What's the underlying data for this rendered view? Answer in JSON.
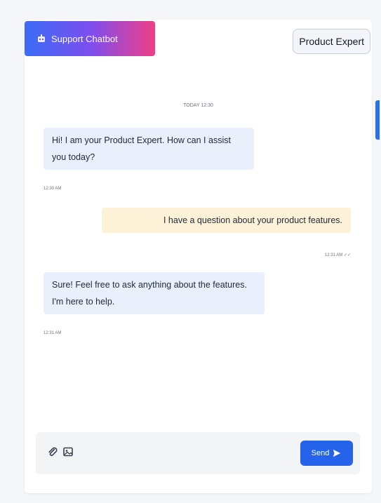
{
  "header": {
    "brand_label": "Support Chatbot",
    "expert_label": "Product Expert"
  },
  "chat": {
    "date_label": "TODAY 12:30",
    "messages": [
      {
        "role": "bot",
        "text": "Hi! I am your Product Expert. How can I assist you today?",
        "time": "12:30 AM"
      },
      {
        "role": "user",
        "text": "I have a question about your product features.",
        "time": "12:31 AM ✓✓"
      },
      {
        "role": "bot",
        "text": "Sure! Feel free to ask anything about the features. I'm here to help.",
        "time": "12:31 AM"
      }
    ]
  },
  "composer": {
    "send_label": "Send"
  },
  "icons": {
    "brand": "bot-icon",
    "attach": "paperclip-icon",
    "image": "image-icon",
    "send": "send-icon"
  },
  "colors": {
    "accent": "#2563eb",
    "bot_bubble": "#e9effb",
    "user_bubble": "#fdf2d8"
  }
}
